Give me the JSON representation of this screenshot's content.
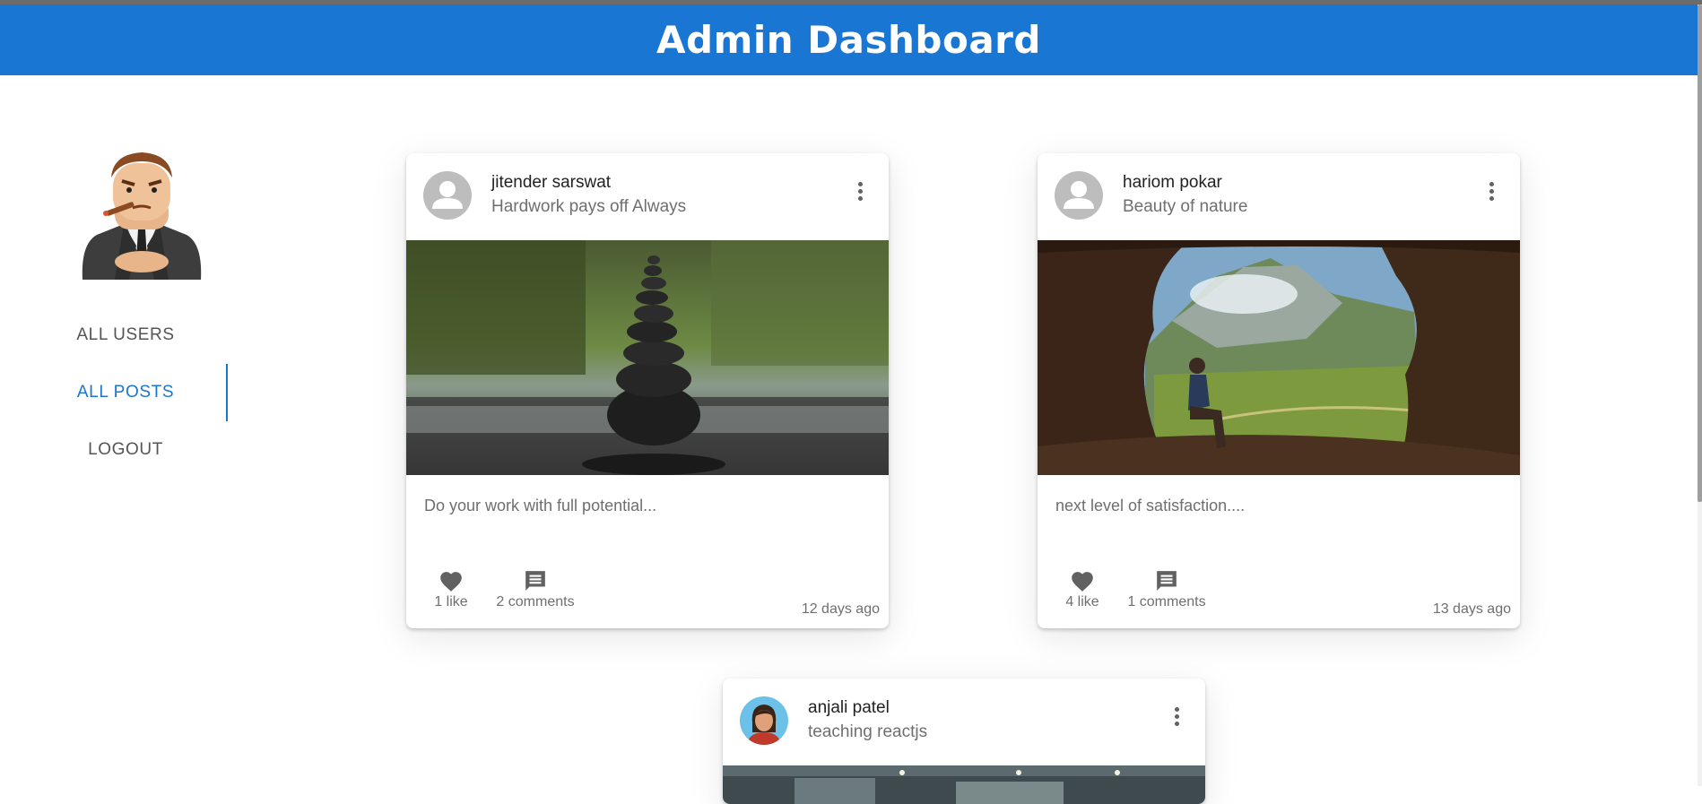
{
  "header": {
    "title": "Admin Dashboard"
  },
  "colors": {
    "primary": "#1976d2",
    "text_secondary": "#6f6f6f",
    "icon": "#616161"
  },
  "sidebar": {
    "avatar_icon": "admin-cartoon-avatar",
    "items": [
      {
        "label": "ALL USERS",
        "active": false
      },
      {
        "label": "ALL POSTS",
        "active": true
      },
      {
        "label": "LOGOUT",
        "active": false
      }
    ]
  },
  "posts": [
    {
      "author": "jitender sarswat",
      "subtitle": "Hardwork pays off Always",
      "avatar": "default-person-icon",
      "image": "stacked-stones-river-photo",
      "caption": "Do your work with full potential...",
      "likes": "1 like",
      "comments": "2 comments",
      "time": "12 days ago"
    },
    {
      "author": "hariom pokar",
      "subtitle": "Beauty of nature",
      "avatar": "default-person-icon",
      "image": "cave-mountain-view-photo",
      "caption": "next level of satisfaction....",
      "likes": "4 like",
      "comments": "1 comments",
      "time": "13 days ago"
    },
    {
      "author": "anjali patel",
      "subtitle": "teaching reactjs",
      "avatar": "woman-avatar",
      "image": "classroom-photo"
    }
  ]
}
